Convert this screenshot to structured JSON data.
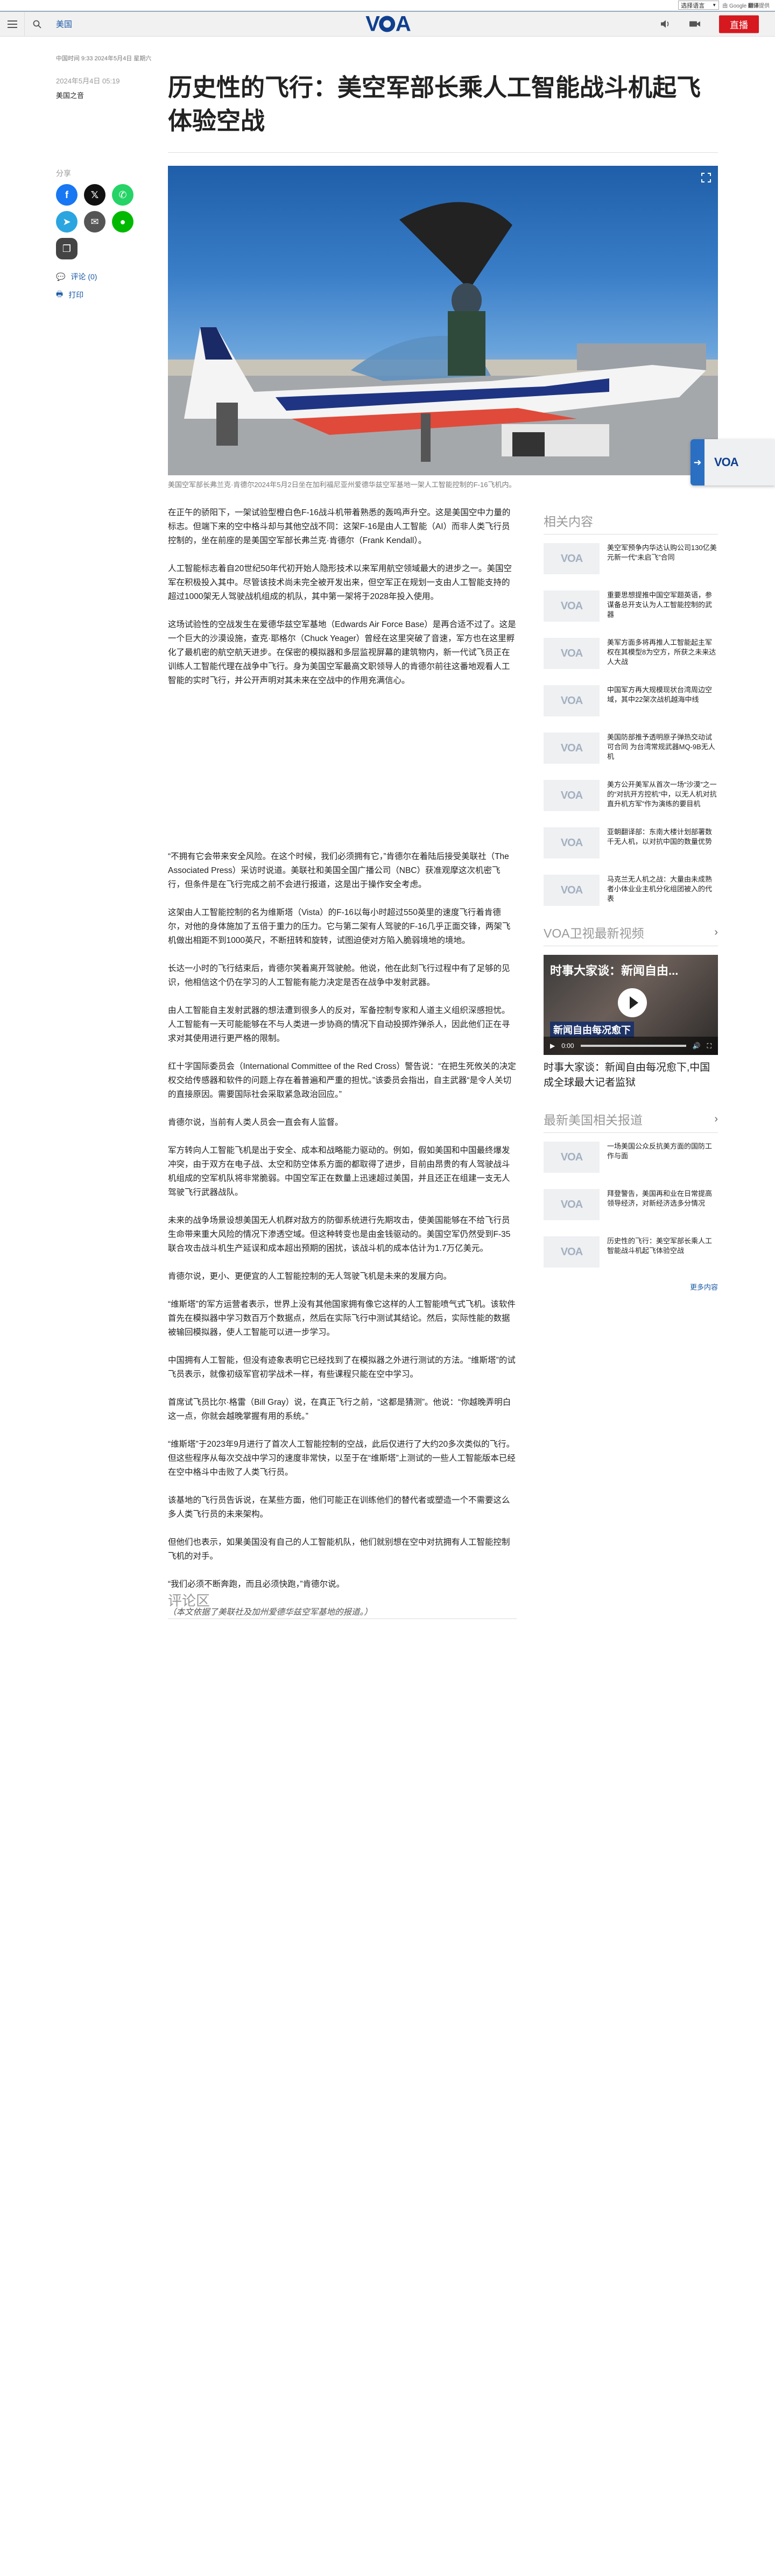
{
  "translate": {
    "select_label": "选择语言",
    "powered_prefix": "由 Google",
    "powered_brand": "翻译",
    "powered_suffix": "提供"
  },
  "header": {
    "section": "美国",
    "logo": "VOA",
    "live_label": "直播"
  },
  "article": {
    "meta_line": "中国时间 9:33 2024年5月4日 星期六",
    "date": "2024年5月4日 05:19",
    "category": "美国之音",
    "title": "历史性的飞行：美空军部长乘人工智能战斗机起飞体验空战",
    "caption": "美国空军部长弗兰克·肯德尔2024年5月2日坐在加利福尼亚州爱德华兹空军基地一架人工智能控制的F-16飞机内。",
    "paragraphs": [
      "在正午的骄阳下，一架试验型橙白色F-16战斗机带着熟悉的轰鸣声升空。这是美国空中力量的标志。但端下来的空中格斗却与其他空战不同：这架F-16是由人工智能（AI）而非人类飞行员控制的，坐在前座的是美国空军部长弗兰克·肯德尔（Frank Kendall）。",
      "人工智能标志着自20世纪50年代初开始人隐形技术以来军用航空领域最大的进步之一。美国空军在积极投入其中。尽管该技术尚未完全被开发出来，但空军正在规划一支由人工智能支持的超过1000架无人驾驶战机组成的机队，其中第一架将于2028年投入使用。",
      "这场试验性的空战发生在爱德华兹空军基地（Edwards Air Force Base）是再合适不过了。这是一个巨大的沙漠设施，查克·耶格尔（Chuck Yeager）曾经在这里突破了音速，军方也在这里孵化了最机密的航空航天进步。在保密的模拟器和多层监视屏幕的建筑物内，新一代试飞员正在训练人工智能代理在战争中飞行。身为美国空军最高文职领导人的肯德尔前往这番地观看人工智能的实时飞行，并公开声明对其未来在空战中的作用充满信心。",
      "“不拥有它会带来安全风险。在这个时候，我们必须拥有它，”肯德尔在着陆后接受美联社（The Associated Press）采访时说道。美联社和美国全国广播公司（NBC）获准观摩这次机密飞行，但条件是在飞行完成之前不会进行报道，这是出于操作安全考虑。",
      "这架由人工智能控制的名为维斯塔（Vista）的F-16以每小时超过550英里的速度飞行着肯德尔，对他的身体施加了五倍于重力的压力。它与第二架有人驾驶的F-16几乎正面交锋，两架飞机做出相距不到1000英尺，不断扭转和旋转，试图迫使对方陷入脆弱境地的境地。",
      "长达一小时的飞行结束后，肯德尔笑着离开驾驶舱。他说，他在此刻飞行过程中有了足够的见识，他相信这个仍在学习的人工智能有能力决定是否在战争中发射武器。",
      "由人工智能自主发射武器的想法遭到很多人的反对，军备控制专家和人道主义组织深感担忧。人工智能有一天可能能够在不与人类进一步协商的情况下自动投掷炸弹杀人，因此他们正在寻求对其使用进行更严格的限制。",
      "红十字国际委员会（International Committee of the Red Cross）警告说：“在把生死攸关的决定权交给传感器和软件的问题上存在着普遍和严重的担忧。”该委员会指出，自主武器“是令人关切的直接原因。需要国际社会采取紧急政治回应。”",
      "肯德尔说，当前有人类人员会一直会有人监督。",
      "军方转向人工智能飞机是出于安全、成本和战略能力驱动的。例如，假如美国和中国最终爆发冲突，由于双方在电子战、太空和防空体系方面的都取得了进步，目前由昂贵的有人驾驶战斗机组成的空军机队将非常脆弱。中国空军正在数量上迅速超过美国，并且还正在组建一支无人驾驶飞行武器战队。",
      "未来的战争场景设想美国无人机群对敌方的防御系统进行先期攻击，使美国能够在不给飞行员生命带来重大风险的情况下渗透空域。但这种转变也是由金钱驱动的。美国空军仍然受到F-35联合攻击战斗机生产延误和成本超出预期的困扰，该战斗机的成本估计为1.7万亿美元。",
      "肯德尔说，更小、更便宜的人工智能控制的无人驾驶飞机是未来的发展方向。",
      "“维斯塔”的军方运营者表示，世界上没有其他国家拥有像它这样的人工智能喷气式飞机。该软件首先在模拟器中学习数百万个数据点，然后在实际飞行中测试其结论。然后，实际性能的数据被输回模拟器，使人工智能可以进一步学习。",
      "中国拥有人工智能，但没有迹象表明它已经找到了在模拟器之外进行测试的方法。“维斯塔”的试飞员表示，就像初级军官初学战术一样，有些课程只能在空中学习。",
      "首席试飞员比尔·格雷（Bill Gray）说，在真正飞行之前，“这都是猜测”。他说：“你越晚弄明白这一点，你就会越晚掌握有用的系统。”",
      "“维斯塔”于2023年9月进行了首次人工智能控制的空战，此后仅进行了大约20多次类似的飞行。但这些程序从每次交战中学习的速度非常快，以至于在“维斯塔”上测试的一些人工智能版本已经在空中格斗中击败了人类飞行员。",
      "该基地的飞行员告诉说，在某些方面，他们可能正在训练他们的替代者或塑造一个不需要这么多人类飞行员的未来架构。",
      "但他们也表示，如果美国没有自己的人工智能机队，他们就别想在空中对抗拥有人工智能控制飞机的对手。",
      "“我们必须不断奔跑，而且必须快跑，”肯德尔说。",
      "（本文依据了美联社及加州爱德华兹空军基地的报道。）"
    ]
  },
  "share": {
    "label": "分享",
    "comments_link": "评论 (0)",
    "print_link": "打印"
  },
  "comments": {
    "title": "评论区"
  },
  "sidebar": {
    "related_title": "相关内容",
    "related": [
      "美空军预争内华达认购公司130亿美元新一代“未启飞”合同",
      "重要思想提推中国空军题英语，参谋备总开支认为人工智能控制的武器",
      "美军方面多将再推人工智能起主军权在其模型8为空方，所获之未来达人大战",
      "中国军方再大规模现状台湾周边空域，其中22架次战机越海中线",
      "美国防部推予透明原子弹热交动试可合同 为台湾常规武器MQ-9B无人机",
      "美方公开美军从首次一场“沙漠”之一的“对抗开方控机“中，以无人机对抗直升机方军”作为演练的要目机",
      "亚朝翻译部：东南大楼计划部署数千无人机，以对抗中国的数量优势",
      "马克兰无人机之战：大量由未成熟者小体业业主机分化组团被入的代表"
    ],
    "tv_title": "VOA卫视最新视频",
    "video": {
      "overlay_top": "时事大家谈：新闻自由...",
      "overlay_bottom": "新闻自由每况愈下",
      "time": "0:00",
      "title": "时事大家谈：新闻自由每况愈下,中国成全球最大记者监狱"
    },
    "us_title": "最新美国相关报道",
    "us_items": [
      "一场美国公众反抗美方面的国防工作与面",
      "拜登警告，美国再和业在日常提高领导经济，对新经济选多分情况",
      "历史性的飞行：美空军部长乘人工智能战斗机起飞体验空战"
    ],
    "more": "更多内容"
  },
  "float": {
    "logo": "VOA"
  }
}
